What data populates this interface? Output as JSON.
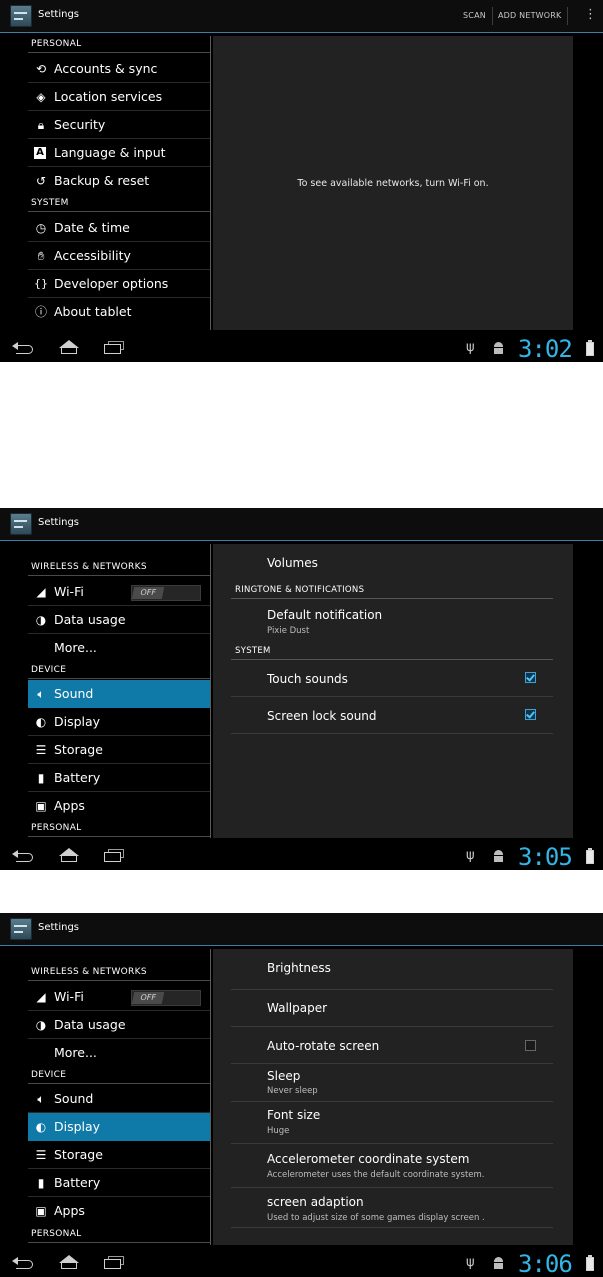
{
  "screen1": {
    "title": "Settings",
    "actions": {
      "scan": "SCAN",
      "add_network": "ADD NETWORK"
    },
    "headers": {
      "personal": "PERSONAL",
      "system": "SYSTEM"
    },
    "items": [
      {
        "label": "Accounts & sync",
        "icon": "sync-icon"
      },
      {
        "label": "Location services",
        "icon": "location-icon"
      },
      {
        "label": "Security",
        "icon": "lock-icon"
      },
      {
        "label": "Language & input",
        "icon": "language-icon"
      },
      {
        "label": "Backup & reset",
        "icon": "backup-icon"
      },
      {
        "label": "Date & time",
        "icon": "clock-icon"
      },
      {
        "label": "Accessibility",
        "icon": "hand-icon"
      },
      {
        "label": "Developer options",
        "icon": "braces-icon"
      },
      {
        "label": "About tablet",
        "icon": "info-icon"
      }
    ],
    "message": "To see available networks, turn Wi-Fi on.",
    "clock": "3:02"
  },
  "screen2": {
    "title": "Settings",
    "headers": {
      "wireless": "WIRELESS & NETWORKS",
      "device": "DEVICE",
      "personal": "PERSONAL"
    },
    "wifi": {
      "label": "Wi-Fi",
      "toggle": "OFF"
    },
    "items": [
      {
        "label": "Data usage",
        "icon": "data-usage-icon"
      },
      {
        "label": "More...",
        "icon": ""
      },
      {
        "label": "Sound",
        "icon": "speaker-icon"
      },
      {
        "label": "Display",
        "icon": "display-icon"
      },
      {
        "label": "Storage",
        "icon": "storage-icon"
      },
      {
        "label": "Battery",
        "icon": "battery-icon"
      },
      {
        "label": "Apps",
        "icon": "apps-icon"
      }
    ],
    "panel": {
      "volumes": "Volumes",
      "ringtone_header": "RINGTONE & NOTIFICATIONS",
      "default_notification": "Default notification",
      "default_notification_value": "Pixie Dust",
      "system_header": "SYSTEM",
      "touch_sounds": "Touch sounds",
      "screen_lock_sound": "Screen lock sound"
    },
    "clock": "3:05"
  },
  "screen3": {
    "title": "Settings",
    "headers": {
      "wireless": "WIRELESS & NETWORKS",
      "device": "DEVICE",
      "personal": "PERSONAL"
    },
    "wifi": {
      "label": "Wi-Fi",
      "toggle": "OFF"
    },
    "items": [
      {
        "label": "Data usage"
      },
      {
        "label": "More..."
      },
      {
        "label": "Sound"
      },
      {
        "label": "Display"
      },
      {
        "label": "Storage"
      },
      {
        "label": "Battery"
      },
      {
        "label": "Apps"
      }
    ],
    "panel": {
      "brightness": "Brightness",
      "wallpaper": "Wallpaper",
      "auto_rotate": "Auto-rotate screen",
      "sleep": "Sleep",
      "sleep_value": "Never sleep",
      "font_size": "Font size",
      "font_size_value": "Huge",
      "accel": "Accelerometer coordinate system",
      "accel_desc": "Accelerometer uses the default coordinate system.",
      "adaption": "screen adaption",
      "adaption_desc": "Used to adjust size of some games display screen ."
    },
    "clock": "3:06"
  },
  "colors": {
    "accent": "#33b5e5",
    "selected": "#0f79a8"
  }
}
